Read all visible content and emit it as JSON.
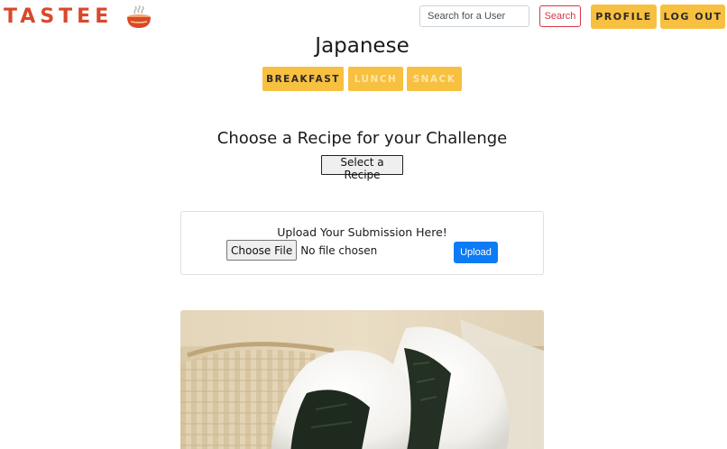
{
  "brand": {
    "name": "TASTEE",
    "logo_icon": "ramen-bowl-icon"
  },
  "header": {
    "search_placeholder": "Search for a User",
    "search_label": "Search",
    "profile_label": "PROFILE",
    "logout_label": "LOG OUT"
  },
  "page": {
    "title": "Japanese"
  },
  "tabs": [
    {
      "label": "BREAKFAST",
      "active": true
    },
    {
      "label": "LUNCH",
      "active": false
    },
    {
      "label": "SNACK",
      "active": false
    }
  ],
  "challenge": {
    "heading": "Choose a Recipe for your Challenge",
    "select_label": "Select a Recipe"
  },
  "upload": {
    "title": "Upload Your Submission Here!",
    "choose_file_label": "Choose File",
    "file_status": "No file chosen",
    "upload_label": "Upload"
  },
  "recipe_image": {
    "subject": "onigiri rice balls with nori"
  },
  "colors": {
    "brand": "#d9482b",
    "accent": "#f8c040",
    "search_outline": "#dc3545",
    "upload_button": "#0d7bf5"
  }
}
